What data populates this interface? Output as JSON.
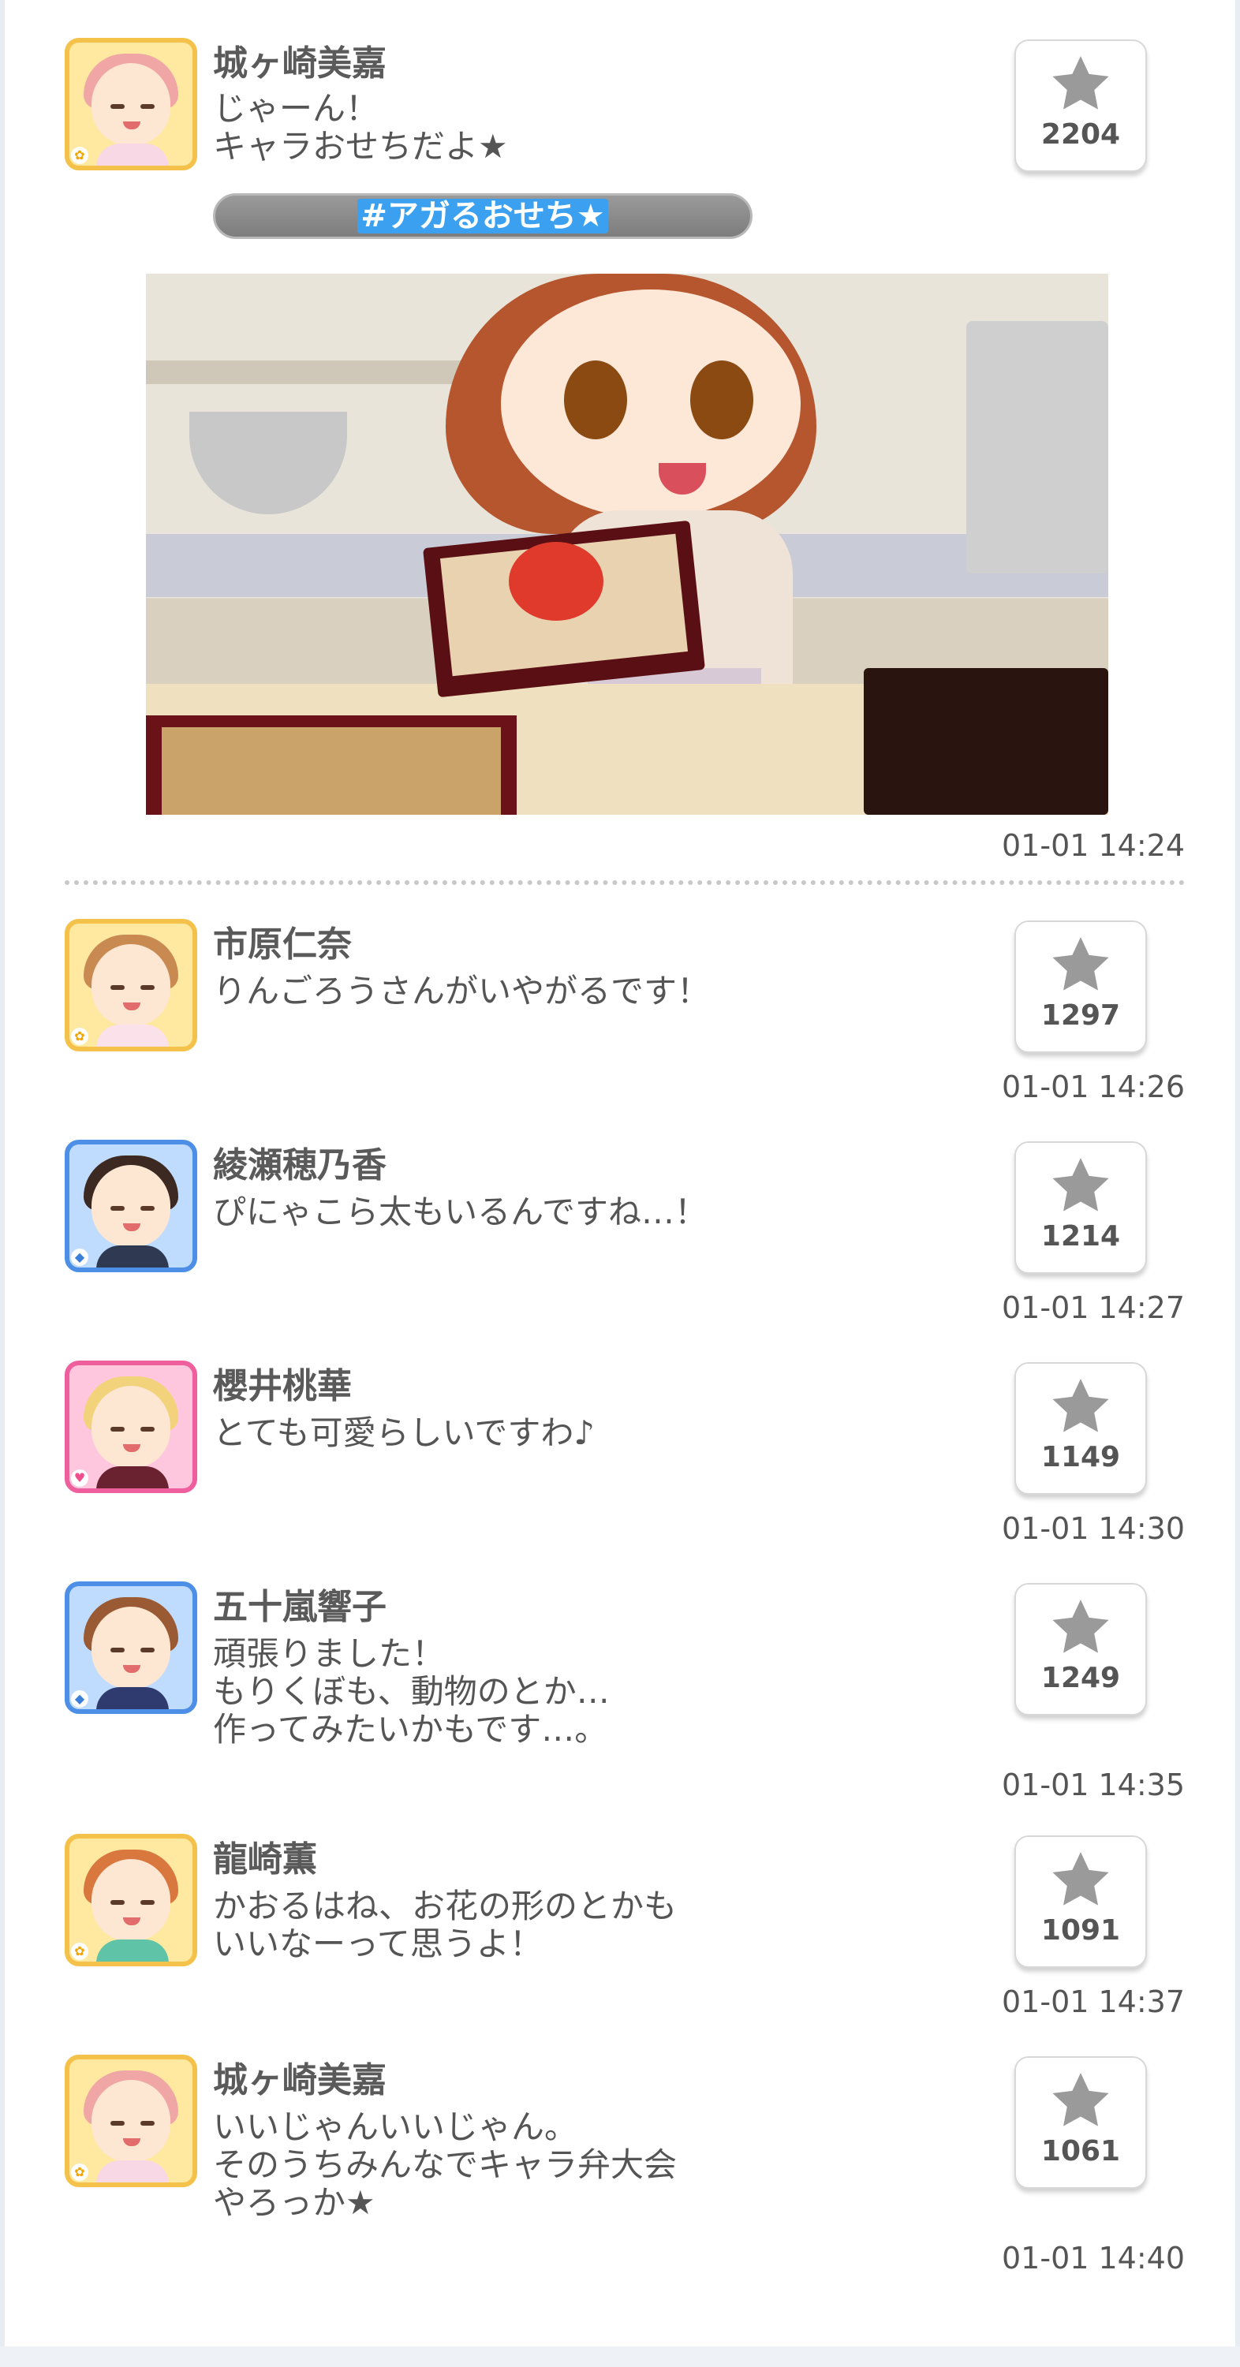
{
  "colors": {
    "hashtag_bg": "#8a8a8a",
    "hashtag_highlight": "#3aa0ef",
    "star": "#9a9a9a"
  },
  "feed": {
    "main_post": {
      "name": "城ヶ崎美嘉",
      "message": "じゃーん！\nキャラおせちだよ★",
      "hashtag": "#アガるおせち★",
      "likes": "2204",
      "time": "01-01 14:24",
      "attribute_icon": "flower-icon"
    },
    "replies": [
      {
        "name": "市原仁奈",
        "message": "りんごろうさんがいやがるです！",
        "likes": "1297",
        "time": "01-01 14:26",
        "attribute_icon": "flower-icon"
      },
      {
        "name": "綾瀬穂乃香",
        "message": "ぴにゃこら太もいるんですね…！",
        "likes": "1214",
        "time": "01-01 14:27",
        "attribute_icon": "diamond-icon"
      },
      {
        "name": "櫻井桃華",
        "message": "とても可愛らしいですわ♪",
        "likes": "1149",
        "time": "01-01 14:30",
        "attribute_icon": "heart-icon"
      },
      {
        "name": "五十嵐響子",
        "message": "頑張りました！\nもりくぼも、動物のとか…\n作ってみたいかもです…。",
        "likes": "1249",
        "time": "01-01 14:35",
        "attribute_icon": "diamond-icon"
      },
      {
        "name": "龍崎薫",
        "message": "かおるはね、お花の形のとかも\nいいなーって思うよ！",
        "likes": "1091",
        "time": "01-01 14:37",
        "attribute_icon": "flower-icon"
      },
      {
        "name": "城ヶ崎美嘉",
        "message": "いいじゃんいいじゃん。\nそのうちみんなでキャラ弁大会\nやろっか★",
        "likes": "1061",
        "time": "01-01 14:40",
        "attribute_icon": "flower-icon"
      }
    ]
  }
}
